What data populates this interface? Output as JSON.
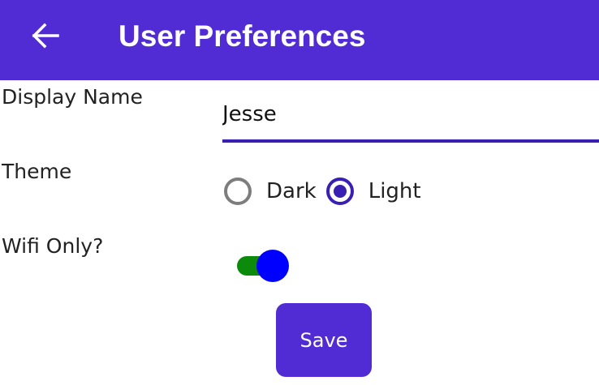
{
  "app_bar": {
    "title": "User Preferences",
    "back_icon": "arrow-left-icon",
    "background": "#512bd4"
  },
  "form": {
    "display_name": {
      "label": "Display Name",
      "value": "Jesse"
    },
    "theme": {
      "label": "Theme",
      "options": [
        {
          "label": "Dark",
          "selected": false
        },
        {
          "label": "Light",
          "selected": true
        }
      ]
    },
    "wifi_only": {
      "label": "Wifi Only?",
      "on": true,
      "track_color": "#0b8a0b",
      "thumb_color": "#0000ff"
    },
    "save_button": {
      "label": "Save",
      "background": "#512bd4"
    }
  }
}
